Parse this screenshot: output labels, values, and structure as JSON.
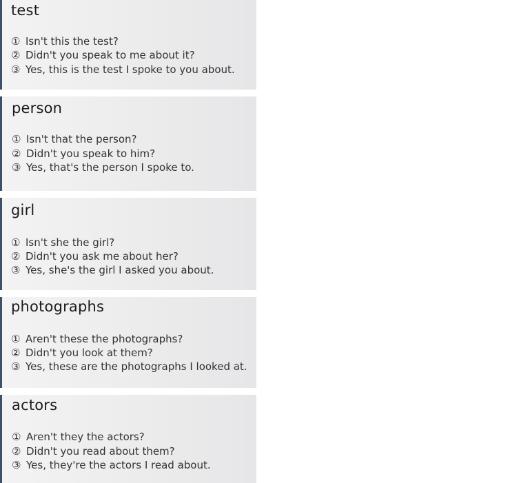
{
  "cards": [
    {
      "title": "test",
      "lines": [
        {
          "num": "①",
          "text": "Isn't this the test?"
        },
        {
          "num": "②",
          "text": "Didn't you speak to me about it?"
        },
        {
          "num": "③",
          "text": "Yes, this is the test I spoke to you about."
        }
      ]
    },
    {
      "title": "person",
      "lines": [
        {
          "num": "①",
          "text": "Isn't that the person?"
        },
        {
          "num": "②",
          "text": "Didn't you speak to him?"
        },
        {
          "num": "③",
          "text": "Yes, that's the person I spoke to."
        }
      ]
    },
    {
      "title": "girl",
      "lines": [
        {
          "num": "①",
          "text": "Isn't she the girl?"
        },
        {
          "num": "②",
          "text": "Didn't you ask me about her?"
        },
        {
          "num": "③",
          "text": "Yes, she's the girl I asked you about."
        }
      ]
    },
    {
      "title": "photographs",
      "lines": [
        {
          "num": "①",
          "text": "Aren't these the photographs?"
        },
        {
          "num": "②",
          "text": "Didn't you look at them?"
        },
        {
          "num": "③",
          "text": "Yes, these are the photographs I looked at."
        }
      ]
    },
    {
      "title": "actors",
      "lines": [
        {
          "num": "①",
          "text": "Aren't they the actors?"
        },
        {
          "num": "②",
          "text": "Didn't you read about them?"
        },
        {
          "num": "③",
          "text": "Yes, they're the actors I read about."
        }
      ]
    }
  ]
}
